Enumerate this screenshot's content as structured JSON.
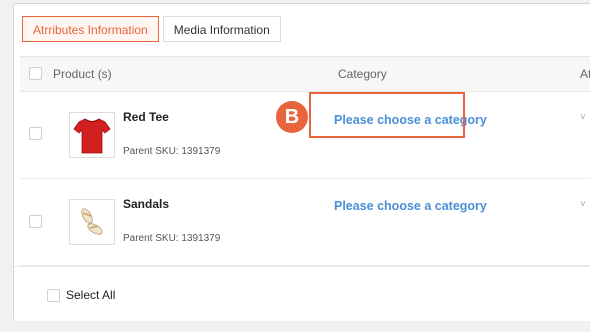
{
  "tabs": [
    {
      "label": "Atrributes Information",
      "active": true
    },
    {
      "label": "Media Information",
      "active": false
    }
  ],
  "table": {
    "headers": {
      "product": "Product (s)",
      "category": "Category",
      "attributes": "At"
    },
    "rows": [
      {
        "name": "Red Tee",
        "sku_label": "Parent SKU:",
        "sku": "1391379",
        "category_link": "Please choose a category",
        "image": "red-tshirt"
      },
      {
        "name": "Sandals",
        "sku_label": "Parent SKU:",
        "sku": "1391379",
        "category_link": "Please choose a category",
        "image": "sandals"
      }
    ],
    "arrow": "˅"
  },
  "annotation": {
    "marker": "B"
  },
  "footer": {
    "select_all": "Select All"
  },
  "colors": {
    "accent": "#e8643c",
    "link": "#4a90d9"
  }
}
